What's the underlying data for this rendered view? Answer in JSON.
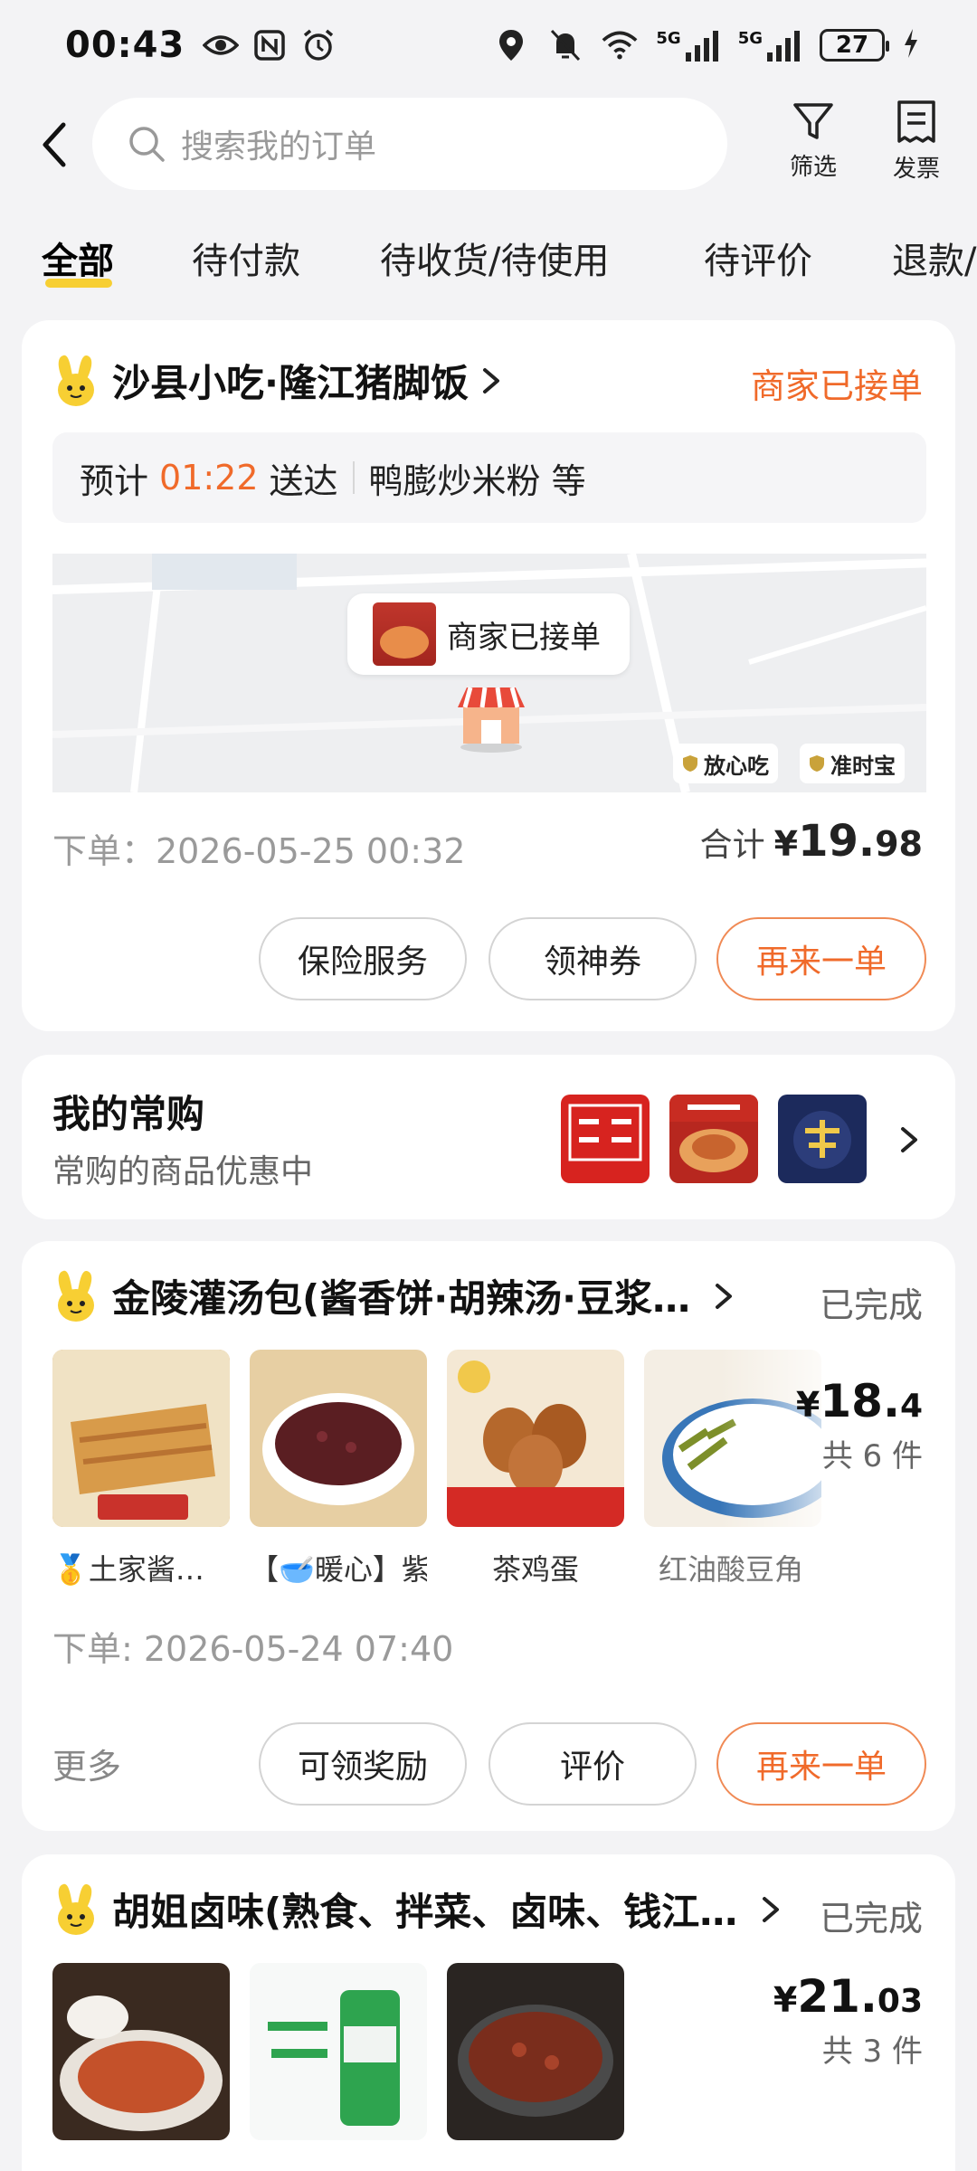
{
  "status_bar": {
    "time": "00:43",
    "battery": "27",
    "network1": "5G",
    "network2": "5G"
  },
  "search": {
    "placeholder": "搜索我的订单"
  },
  "header": {
    "filter_label": "筛选",
    "invoice_label": "发票"
  },
  "tabs": [
    {
      "label": "全部",
      "active": true
    },
    {
      "label": "待付款"
    },
    {
      "label": "待收货/待使用"
    },
    {
      "label": "待评价"
    },
    {
      "label": "退款/"
    }
  ],
  "orders": [
    {
      "shop": "沙县小吃·隆江猪脚饭",
      "status": "商家已接单",
      "eta_prefix": "预计",
      "eta_time": "01:22",
      "eta_suffix": "送达",
      "items_summary": "鸭膨炒米粉 等",
      "map_bubble": "商家已接单",
      "badges": [
        "放心吃",
        "准时宝"
      ],
      "order_time": "下单：2026-05-25 00:32",
      "total_label": "合计",
      "currency": "¥",
      "total_int": "19.",
      "total_dec": "98",
      "buttons": [
        "保险服务",
        "领神券",
        "再来一单"
      ]
    },
    {
      "shop": "金陵灌汤包(酱香饼·胡辣汤·豆浆…",
      "status": "已完成",
      "items": [
        "🥇土家酱…",
        "【🥣暖心】紫…",
        "茶鸡蛋",
        "红油酸豆角"
      ],
      "currency": "¥",
      "total_int": "18.",
      "total_dec": "4",
      "count": "共 6 件",
      "order_time": "下单: 2026-05-24 07:40",
      "more": "更多",
      "buttons": [
        "可领奖励",
        "评价",
        "再来一单"
      ]
    },
    {
      "shop": "胡姐卤味(熟食、拌菜、卤味、钱江…",
      "status": "已完成",
      "currency": "¥",
      "total_int": "21.",
      "total_dec": "03",
      "count": "共 3 件"
    }
  ],
  "frequent": {
    "title": "我的常购",
    "subtitle": "常购的商品优惠中"
  },
  "colors": {
    "accent": "#f06a2a",
    "tab_indicator": "#f7cf33",
    "background": "#f3f3f5"
  }
}
